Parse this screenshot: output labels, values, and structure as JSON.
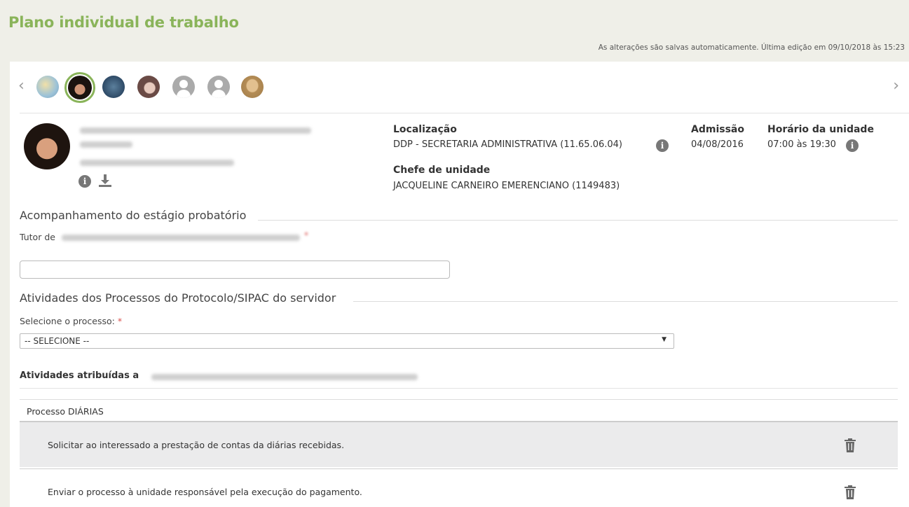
{
  "page": {
    "title": "Plano individual de trabalho",
    "save_status": "As alterações são salvas automaticamente. Última edição em 09/10/2018 às 15:23"
  },
  "carousel": {
    "prev": "‹",
    "next": "›"
  },
  "profile": {
    "localizacao_label": "Localização",
    "localizacao_value": "DDP - SECRETARIA ADMINISTRATIVA (11.65.06.04)",
    "chefe_label": "Chefe de unidade",
    "chefe_value": "JACQUELINE CARNEIRO EMERENCIANO (1149483)",
    "admissao_label": "Admissão",
    "admissao_value": "04/08/2016",
    "horario_label": "Horário da unidade",
    "horario_value": "07:00 às 19:30"
  },
  "probation": {
    "section_title": "Acompanhamento do estágio probatório",
    "tutor_label": "Tutor de"
  },
  "processes": {
    "section_title": "Atividades dos Processos do Protocolo/SIPAC do servidor",
    "select_label": "Selecione o processo:",
    "select_value": "-- SELECIONE --",
    "assigned_label": "Atividades atribuídas a",
    "group_title": "Processo DIÁRIAS",
    "activities": [
      "Solicitar ao interessado a prestação de contas da diárias recebidas.",
      "Enviar o processo à unidade responsável pela execução do pagamento."
    ]
  },
  "colors": {
    "accent": "#8ab45a",
    "required": "#d9534f",
    "background": "#efefe8"
  },
  "icons": [
    "chevron-left-icon",
    "chevron-right-icon",
    "info-icon",
    "download-icon",
    "trash-icon"
  ]
}
